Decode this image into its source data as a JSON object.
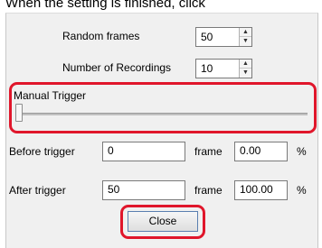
{
  "caption": "When the setting is finished, click",
  "settings": {
    "random_frames": {
      "label": "Random frames",
      "value": "50"
    },
    "num_recordings": {
      "label": "Number of Recordings",
      "value": "10"
    }
  },
  "manual_trigger": {
    "label": "Manual Trigger",
    "position_fraction": 0.0
  },
  "before_trigger": {
    "label": "Before trigger",
    "value": "0",
    "unit": "frame",
    "percent": "0.00",
    "percent_sign": "%"
  },
  "after_trigger": {
    "label": "After trigger",
    "value": "50",
    "unit": "frame",
    "percent": "100.00",
    "percent_sign": "%"
  },
  "close_button": {
    "label": "Close"
  },
  "icons": {
    "spin_up": "▲",
    "spin_down": "▼"
  },
  "colors": {
    "highlight": "#e0162b",
    "dialog_bg": "#f0f0f0",
    "button_border": "#5a7fb0"
  }
}
